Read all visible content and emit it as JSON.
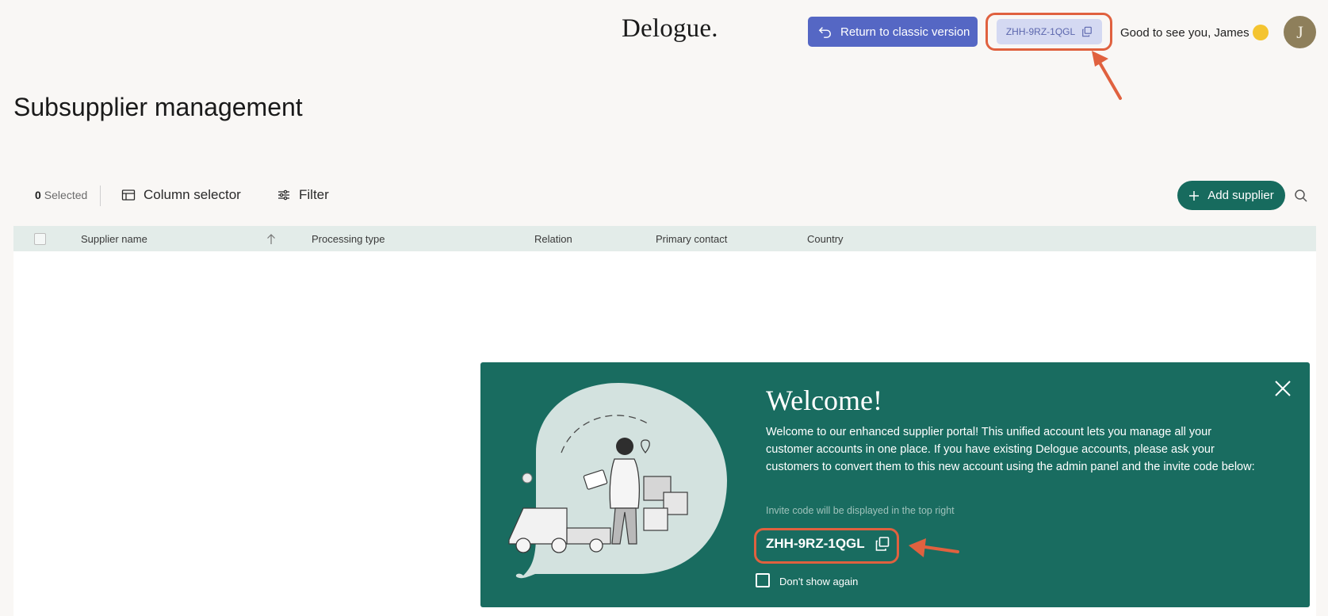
{
  "header": {
    "logo": "Delogue.",
    "classic_button": "Return to classic version",
    "invite_code": "ZHH-9RZ-1QGL",
    "greeting": "Good to see you, James",
    "avatar_initial": "J"
  },
  "page": {
    "title": "Subsupplier management"
  },
  "toolbar": {
    "selected_count": "0",
    "selected_label": "Selected",
    "column_selector": "Column selector",
    "filter": "Filter",
    "add_supplier": "Add supplier"
  },
  "table": {
    "columns": [
      "Supplier name",
      "Processing type",
      "Relation",
      "Primary contact",
      "Country"
    ]
  },
  "welcome": {
    "title": "Welcome!",
    "body": "Welcome to our enhanced supplier portal! This unified account lets you manage all your customer accounts in one place. If you have existing Delogue accounts, please ask your customers to convert them to this new account using the admin panel and the invite code below:",
    "invite_note": "Invite code will be displayed in the top right",
    "invite_code": "ZHH-9RZ-1QGL",
    "dont_show": "Don't show again"
  },
  "colors": {
    "accent_blue": "#5567c4",
    "brand_green": "#196c60",
    "highlight": "#e0613f"
  }
}
